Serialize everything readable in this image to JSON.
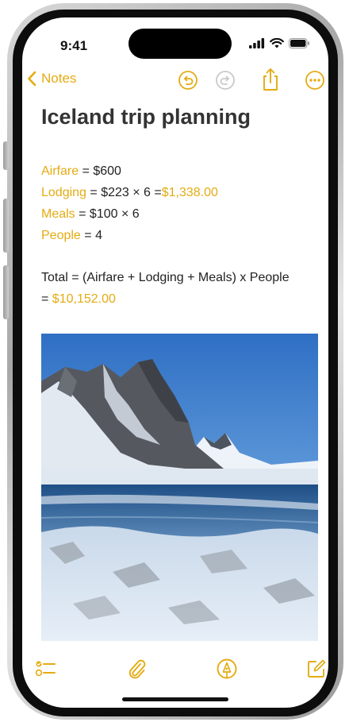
{
  "status_bar": {
    "time": "9:41"
  },
  "nav": {
    "back_label": "Notes",
    "icons": [
      "chevron-left-icon",
      "undo-icon",
      "redo-icon",
      "share-icon",
      "more-icon"
    ]
  },
  "note": {
    "title": "Iceland trip planning",
    "lines": [
      {
        "variable": "Airfare",
        "expression": " = $600",
        "result": ""
      },
      {
        "variable": "Lodging",
        "expression": " = $223 × 6 =",
        "result": "$1,338.00"
      },
      {
        "variable": "Meals",
        "expression": " = $100 × 6",
        "result": ""
      },
      {
        "variable": "People",
        "expression": " = 4",
        "result": ""
      }
    ],
    "total_expression": "Total = (Airfare + Lodging + Meals)  x People",
    "total_prefix": "= ",
    "total_result": "$10,152.00"
  },
  "photo": {
    "subject": "snowy mountain landscape"
  },
  "toolbar": {
    "icons": [
      "checklist-icon",
      "paperclip-icon",
      "markup-pen-icon",
      "compose-icon"
    ]
  },
  "colors": {
    "accent": "#e4ab12",
    "text": "#222222",
    "title": "#333333"
  }
}
